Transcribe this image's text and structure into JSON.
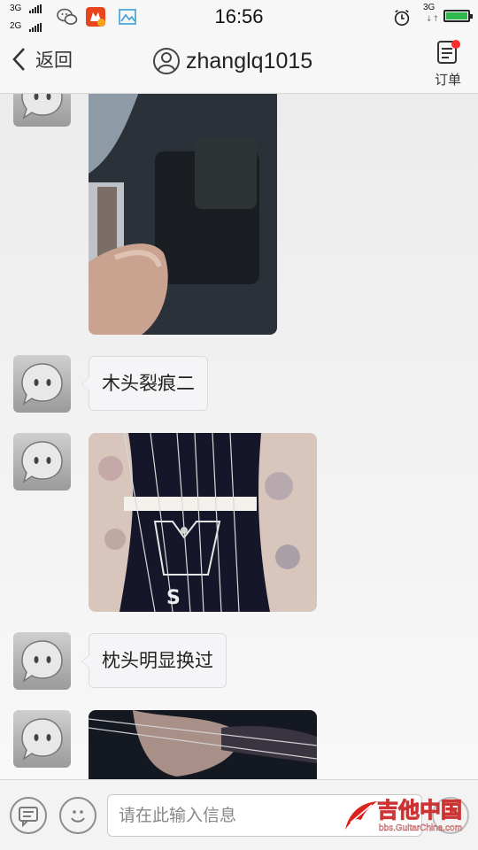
{
  "status_bar": {
    "sim1_type": "3G",
    "sim2_type": "2G",
    "time": "16:56",
    "data_type": "3G",
    "notification_icons": [
      "wechat-icon",
      "app-badge-icon",
      "gallery-icon"
    ],
    "alarm_icon": "alarm-clock-icon",
    "battery_color": "#2db84d"
  },
  "nav": {
    "back_label": "返回",
    "title": "zhanglq1015",
    "order_label": "订单",
    "order_badge_color": "#ff2d2d"
  },
  "messages": [
    {
      "type": "image",
      "description_icon": "guitar-wood-crack-photo"
    },
    {
      "type": "text",
      "text": "木头裂痕二"
    },
    {
      "type": "image",
      "description_icon": "guitar-bridge-strings-photo"
    },
    {
      "type": "text",
      "text": "枕头明显换过"
    },
    {
      "type": "image",
      "description_icon": "guitar-headstock-photo"
    }
  ],
  "input": {
    "placeholder": "请在此输入信息",
    "left_icon": "message-list-icon",
    "emoji_icon": "emoji-face-icon"
  },
  "watermark": {
    "brand": "吉他中国",
    "url": "bbs.GuitarChina.com"
  }
}
